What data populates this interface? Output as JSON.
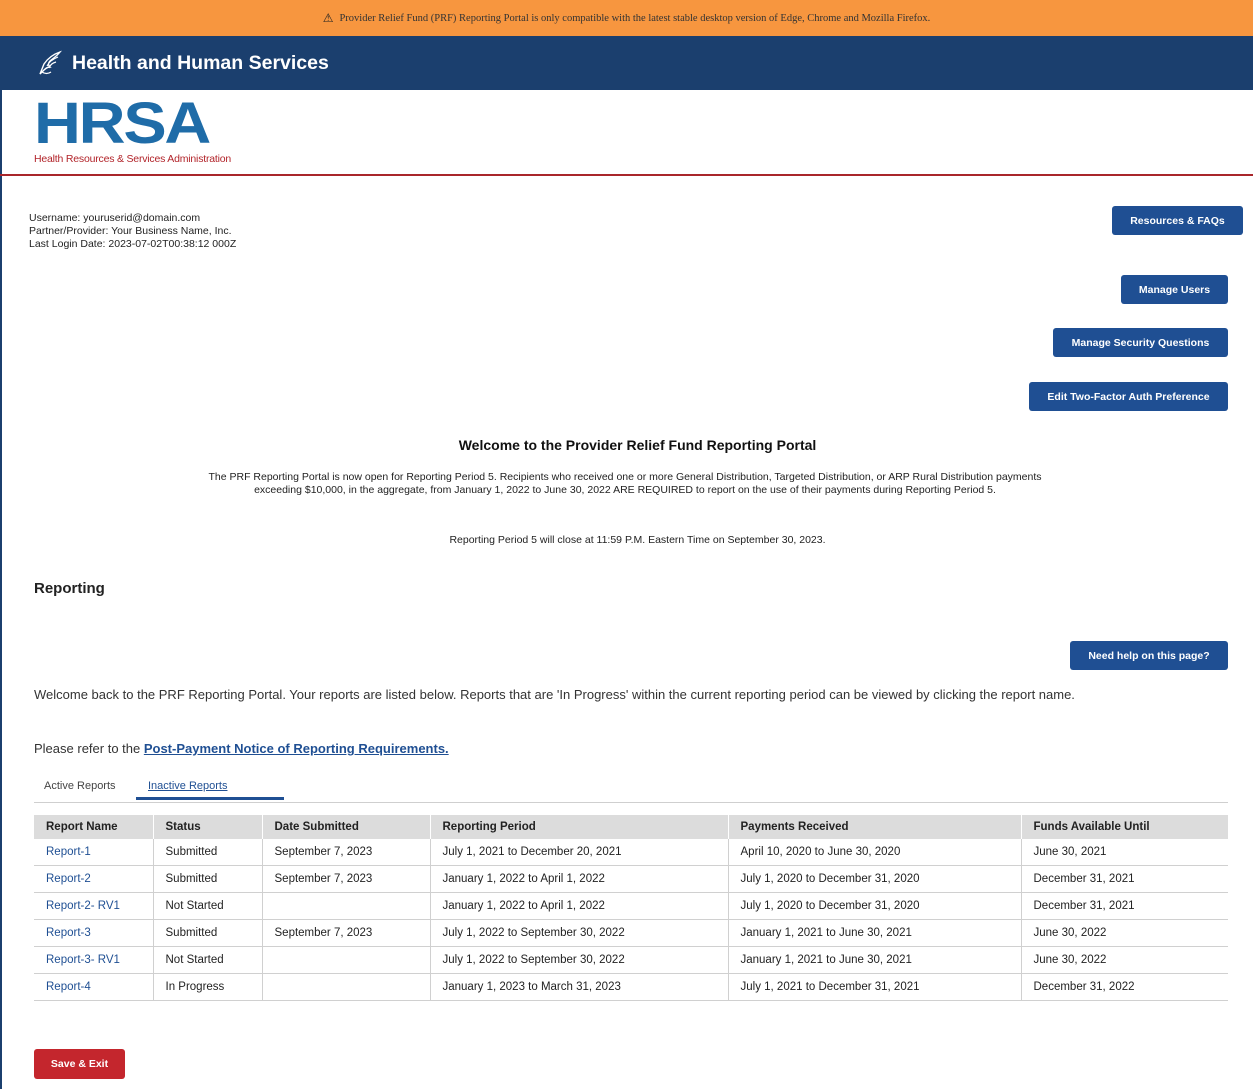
{
  "banner": {
    "icon": "warning-triangle-icon",
    "text": "Provider Relief Fund (PRF) Reporting Portal is only compatible with the latest stable desktop version of Edge, Chrome and Mozilla Firefox."
  },
  "header": {
    "title": "Health and Human Services",
    "logo_big": "HRSA",
    "logo_small": "Health Resources & Services Administration"
  },
  "user": {
    "username": "Username: youruserid@domain.com",
    "partner": "Partner/Provider: Your Business Name, Inc.",
    "last_login": "Last Login Date: 2023-07-02T00:38:12 000Z"
  },
  "buttons": {
    "resources": "Resources & FAQs",
    "manage_users": "Manage Users",
    "security_questions": "Manage Security Questions",
    "two_factor": "Edit Two-Factor Auth Preference",
    "help": "Need help on this page?",
    "save_exit": "Save & Exit"
  },
  "welcome": {
    "title": "Welcome to the Provider Relief Fund Reporting Portal",
    "body": "The PRF Reporting Portal  is now open for Reporting Period 5. Recipients who received one or more General Distribution, Targeted Distribution, or ARP Rural Distribution payments exceeding $10,000, in the aggregate, from January 1, 2022 to June 30, 2022 ARE REQUIRED to report on the use of their payments during Reporting Period 5.",
    "close": "Reporting Period 5 will close at 11:59 P.M. Eastern Time on September 30, 2023."
  },
  "reporting": {
    "section_title": "Reporting",
    "intro": "Welcome back to the PRF Reporting Portal. Your reports are listed below. Reports that are 'In Progress' within the current reporting period can be viewed by clicking the report name.",
    "refer_prefix": "Please refer to the ",
    "refer_link": "Post-Payment Notice of Reporting Requirements."
  },
  "tabs": {
    "active": "Active Reports",
    "inactive": "Inactive Reports"
  },
  "table": {
    "headers": [
      "Report Name",
      "Status",
      "Date Submitted",
      "Reporting Period",
      "Payments Received",
      "Funds Available Until"
    ],
    "rows": [
      [
        "Report-1",
        "Submitted",
        "September 7, 2023",
        "July 1, 2021 to December 20, 2021",
        "April 10, 2020 to June 30, 2020",
        "June 30, 2021"
      ],
      [
        "Report-2",
        "Submitted",
        "September 7, 2023",
        "January 1, 2022 to April 1, 2022",
        "July 1, 2020 to December 31, 2020",
        "December 31, 2021"
      ],
      [
        "Report-2- RV1",
        "Not Started",
        "",
        "January 1, 2022 to April 1, 2022",
        "July 1, 2020 to December 31, 2020",
        "December 31, 2021"
      ],
      [
        "Report-3",
        "Submitted",
        "September 7, 2023",
        "July 1, 2022 to September 30, 2022",
        "January 1, 2021 to June 30, 2021",
        "June 30, 2022"
      ],
      [
        "Report-3- RV1",
        "Not Started",
        "",
        "July 1, 2022 to September 30, 2022",
        "January 1, 2021 to June 30, 2021",
        "June 30, 2022"
      ],
      [
        "Report-4",
        "In Progress",
        "",
        "January 1, 2023 to March 31, 2023",
        "July 1, 2021 to December 31, 2021",
        "December 31, 2022"
      ]
    ]
  },
  "colors": {
    "banner": "#f7963f",
    "topbar": "#1b3f6e",
    "primary_button": "#1f4f93",
    "danger_button": "#c4262d",
    "hrsa_blue": "#1f6ca8",
    "hrsa_red": "#b2242a"
  }
}
